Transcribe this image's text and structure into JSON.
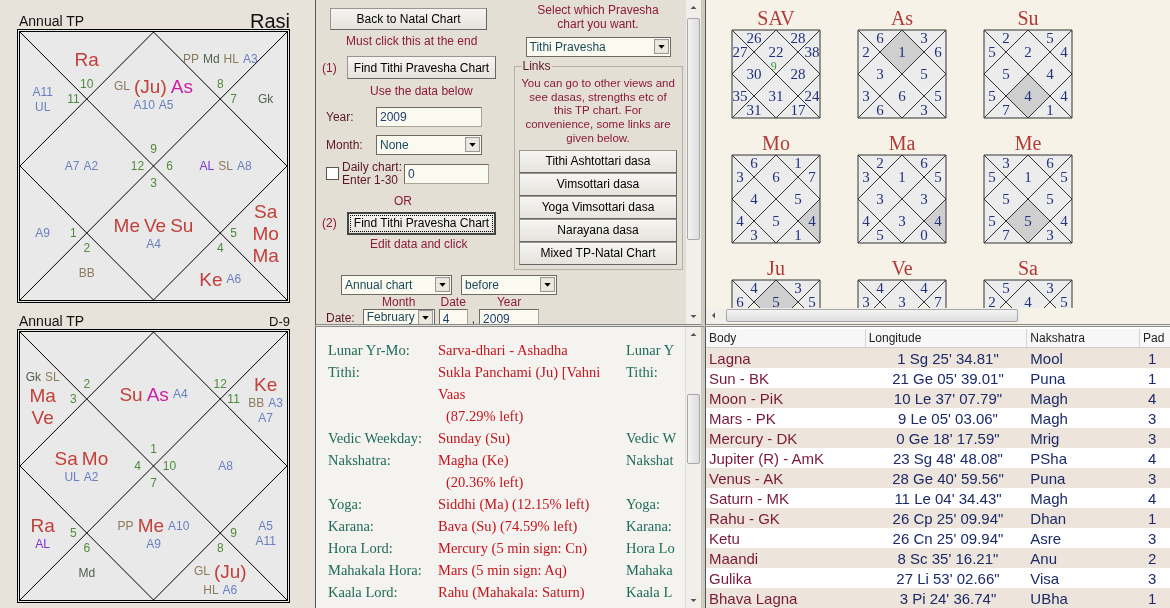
{
  "rasi_chart": {
    "title": "Annual TP",
    "name": "Rasi",
    "houses": [
      {
        "sign": "10",
        "items": [
          {
            "text": "Ra",
            "kind": "graha"
          }
        ]
      },
      {
        "sign": "8",
        "items": [
          {
            "text": "PP",
            "kind": "special_lagna"
          },
          {
            "text": "Md",
            "kind": "upagraha"
          },
          {
            "text": "HL",
            "kind": "special_lagna"
          },
          {
            "text": "A3",
            "kind": "arudha"
          }
        ]
      },
      {
        "sign": "11",
        "items": [
          {
            "text": "A11",
            "kind": "arudha"
          },
          {
            "text": "UL",
            "kind": "arudha"
          }
        ]
      },
      {
        "sign": "9",
        "items": [
          {
            "text": "GL",
            "kind": "special_lagna"
          },
          {
            "text": "(Ju)",
            "kind": "graha"
          },
          {
            "text": "As",
            "kind": "ascendant"
          },
          {
            "text": "A10",
            "kind": "arudha"
          },
          {
            "text": "A5",
            "kind": "arudha"
          }
        ]
      },
      {
        "sign": "7",
        "items": [
          {
            "text": "Gk",
            "kind": "upagraha"
          }
        ]
      },
      {
        "sign": "12",
        "items": [
          {
            "text": "A7",
            "kind": "arudha"
          },
          {
            "text": "A2",
            "kind": "arudha"
          }
        ]
      },
      {
        "sign": "6",
        "items": [
          {
            "text": "AL",
            "kind": "arudha_lagna"
          },
          {
            "text": "SL",
            "kind": "special_lagna"
          },
          {
            "text": "A8",
            "kind": "arudha"
          }
        ]
      },
      {
        "sign": "1",
        "items": [
          {
            "text": "A9",
            "kind": "arudha"
          }
        ]
      },
      {
        "sign": "3",
        "items": [
          {
            "text": "Me",
            "kind": "graha"
          },
          {
            "text": "Ve",
            "kind": "graha"
          },
          {
            "text": "Su",
            "kind": "graha"
          },
          {
            "text": "A4",
            "kind": "arudha"
          }
        ]
      },
      {
        "sign": "5",
        "items": [
          {
            "text": "Sa",
            "kind": "graha"
          },
          {
            "text": "Mo",
            "kind": "graha"
          },
          {
            "text": "Ma",
            "kind": "graha"
          }
        ]
      },
      {
        "sign": "2",
        "items": [
          {
            "text": "BB",
            "kind": "special_lagna"
          }
        ]
      },
      {
        "sign": "4",
        "items": [
          {
            "text": "Ke",
            "kind": "graha"
          },
          {
            "text": "A6",
            "kind": "arudha"
          }
        ]
      }
    ]
  },
  "navamsa_chart": {
    "title": "Annual TP",
    "name": "D-9",
    "houses": [
      {
        "sign": "2"
      },
      {
        "sign": "12"
      },
      {
        "sign": "3",
        "items": [
          {
            "text": "Gk",
            "kind": "upagraha"
          },
          {
            "text": "SL",
            "kind": "special_lagna"
          },
          {
            "text": "Ma",
            "kind": "graha"
          },
          {
            "text": "Ve",
            "kind": "graha"
          }
        ]
      },
      {
        "sign": "1",
        "items": [
          {
            "text": "Su",
            "kind": "graha"
          },
          {
            "text": "As",
            "kind": "ascendant"
          },
          {
            "text": "A4",
            "kind": "arudha"
          }
        ]
      },
      {
        "sign": "11",
        "items": [
          {
            "text": "Ke",
            "kind": "graha"
          },
          {
            "text": "BB",
            "kind": "special_lagna"
          },
          {
            "text": "A3",
            "kind": "arudha"
          },
          {
            "text": "A7",
            "kind": "arudha"
          }
        ]
      },
      {
        "sign": "4",
        "items": [
          {
            "text": "Sa",
            "kind": "graha"
          },
          {
            "text": "Mo",
            "kind": "graha"
          },
          {
            "text": "UL",
            "kind": "arudha"
          },
          {
            "text": "A2",
            "kind": "arudha"
          }
        ]
      },
      {
        "sign": "10",
        "items": [
          {
            "text": "A8",
            "kind": "arudha"
          }
        ]
      },
      {
        "sign": "5",
        "items": [
          {
            "text": "Ra",
            "kind": "graha"
          },
          {
            "text": "AL",
            "kind": "arudha_lagna"
          }
        ]
      },
      {
        "sign": "7",
        "items": [
          {
            "text": "PP",
            "kind": "special_lagna"
          },
          {
            "text": "Me",
            "kind": "graha"
          },
          {
            "text": "A10",
            "kind": "arudha"
          },
          {
            "text": "A9",
            "kind": "arudha"
          }
        ]
      },
      {
        "sign": "9",
        "items": [
          {
            "text": "A5",
            "kind": "arudha"
          },
          {
            "text": "A11",
            "kind": "arudha"
          }
        ]
      },
      {
        "sign": "6",
        "items": [
          {
            "text": "Md",
            "kind": "upagraha"
          }
        ]
      },
      {
        "sign": "8",
        "items": [
          {
            "text": "GL",
            "kind": "special_lagna"
          },
          {
            "text": "(Ju)",
            "kind": "graha"
          },
          {
            "text": "HL",
            "kind": "special_lagna"
          },
          {
            "text": "A6",
            "kind": "arudha"
          }
        ]
      }
    ]
  },
  "form": {
    "back_button": "Back to Natal Chart",
    "back_note": "Must click this at the end",
    "step_1": "(1)",
    "find_button_1": "Find Tithi Pravesha Chart",
    "note_1": "Use the data below",
    "year_label": "Year:",
    "year": "2009",
    "month_label": "Month:",
    "month": "None",
    "daily_chart": {
      "label": "Daily chart: Enter 1-30",
      "checked": false,
      "value": "0"
    },
    "or": "OR",
    "step_2": "(2)",
    "find_button_2": {
      "label": "Find Tithi Pravesha Chart",
      "focused": true
    },
    "note_2": "Edit data and click",
    "chart_type": "Annual chart",
    "direction": "before",
    "date": {
      "label": "Date:",
      "month_label": "Month",
      "month": "February",
      "date_label": "Date",
      "date": "4",
      "separator": ",",
      "year_label": "Year",
      "year": "2009"
    },
    "pravesha_prompt": "Select which Pravesha chart you want.",
    "pravesha_type": "Tithi Pravesha",
    "links": {
      "title": "Links",
      "text": "You can go to other views and see dasas, strengths etc of this TP chart. For convenience, some links are given below.",
      "buttons": [
        "Tithi Ashtottari dasa",
        "Vimsottari dasa",
        "Yoga Vimsottari dasa",
        "Narayana dasa",
        "Mixed TP-Natal Chart"
      ]
    }
  },
  "panchanga": [
    {
      "label": "Lunar Yr-Mo:",
      "value": "Sarva-dhari - Ashadha",
      "label_2": "Lunar Y"
    },
    {
      "label": "Tithi:",
      "value": "Sukla Panchami (Ju) [Vahni Vaas",
      "note": "(87.29% left)",
      "label_2": "Tithi:"
    },
    {
      "label": "Vedic Weekday:",
      "value": "Sunday (Su)",
      "label_2": "Vedic W"
    },
    {
      "label": "Nakshatra:",
      "value": "Magha (Ke)",
      "note": "(20.36% left)",
      "label_2": "Nakshat"
    },
    {
      "label": "Yoga:",
      "value": "Siddhi (Ma) (12.15% left)",
      "label_2": "Yoga:"
    },
    {
      "label": "Karana:",
      "value": "Bava (Su) (74.59% left)",
      "label_2": "Karana:"
    },
    {
      "label": "Hora Lord:",
      "value": "Mercury (5 min sign: Cn)",
      "label_2": "Hora Lo"
    },
    {
      "label": "Mahakala Hora:",
      "value": "Mars (5 min sign: Aq)",
      "label_2": "Mahaka"
    },
    {
      "label": "Kaala Lord:",
      "value": "Rahu (Mahakala: Saturn)",
      "label_2": "Kaala L"
    }
  ],
  "ashtakavarga": [
    {
      "title": "SAV",
      "sign": "9",
      "houses": [
        {
          "value": "26",
          "highlighted": false
        },
        {
          "value": "28",
          "highlighted": false
        },
        {
          "value": "27",
          "highlighted": false
        },
        {
          "value": "22",
          "highlighted": false
        },
        {
          "value": "38",
          "highlighted": false
        },
        {
          "value": "30",
          "highlighted": false
        },
        {
          "value": "28",
          "highlighted": false
        },
        {
          "value": "35",
          "highlighted": false
        },
        {
          "value": "31",
          "highlighted": false
        },
        {
          "value": "24",
          "highlighted": false
        },
        {
          "value": "31",
          "highlighted": false
        },
        {
          "value": "17",
          "highlighted": false
        }
      ]
    },
    {
      "title": "As",
      "houses": [
        {
          "value": "6",
          "highlighted": false
        },
        {
          "value": "3",
          "highlighted": false
        },
        {
          "value": "2",
          "highlighted": false
        },
        {
          "value": "1",
          "highlighted": true
        },
        {
          "value": "6",
          "highlighted": false
        },
        {
          "value": "3",
          "highlighted": false
        },
        {
          "value": "5",
          "highlighted": false
        },
        {
          "value": "3",
          "highlighted": false
        },
        {
          "value": "6",
          "highlighted": false
        },
        {
          "value": "5",
          "highlighted": false
        },
        {
          "value": "6",
          "highlighted": false
        },
        {
          "value": "3",
          "highlighted": false
        }
      ]
    },
    {
      "title": "Su",
      "houses": [
        {
          "value": "2",
          "highlighted": false
        },
        {
          "value": "5",
          "highlighted": false
        },
        {
          "value": "5",
          "highlighted": false
        },
        {
          "value": "2",
          "highlighted": false
        },
        {
          "value": "4",
          "highlighted": false
        },
        {
          "value": "5",
          "highlighted": false
        },
        {
          "value": "4",
          "highlighted": false
        },
        {
          "value": "5",
          "highlighted": false
        },
        {
          "value": "4",
          "highlighted": true
        },
        {
          "value": "4",
          "highlighted": false
        },
        {
          "value": "7",
          "highlighted": false
        },
        {
          "value": "1",
          "highlighted": false
        }
      ]
    },
    {
      "title": "Mo",
      "houses": [
        {
          "value": "6",
          "highlighted": false
        },
        {
          "value": "1",
          "highlighted": false
        },
        {
          "value": "3",
          "highlighted": false
        },
        {
          "value": "6",
          "highlighted": false
        },
        {
          "value": "7",
          "highlighted": false
        },
        {
          "value": "4",
          "highlighted": false
        },
        {
          "value": "5",
          "highlighted": false
        },
        {
          "value": "4",
          "highlighted": false
        },
        {
          "value": "5",
          "highlighted": false
        },
        {
          "value": "4",
          "highlighted": true
        },
        {
          "value": "3",
          "highlighted": false
        },
        {
          "value": "1",
          "highlighted": false
        }
      ]
    },
    {
      "title": "Ma",
      "houses": [
        {
          "value": "2",
          "highlighted": false
        },
        {
          "value": "6",
          "highlighted": false
        },
        {
          "value": "3",
          "highlighted": false
        },
        {
          "value": "1",
          "highlighted": false
        },
        {
          "value": "5",
          "highlighted": false
        },
        {
          "value": "3",
          "highlighted": false
        },
        {
          "value": "3",
          "highlighted": false
        },
        {
          "value": "4",
          "highlighted": false
        },
        {
          "value": "3",
          "highlighted": false
        },
        {
          "value": "4",
          "highlighted": true
        },
        {
          "value": "5",
          "highlighted": false
        },
        {
          "value": "0",
          "highlighted": false
        }
      ]
    },
    {
      "title": "Me",
      "houses": [
        {
          "value": "3",
          "highlighted": false
        },
        {
          "value": "6",
          "highlighted": false
        },
        {
          "value": "5",
          "highlighted": false
        },
        {
          "value": "1",
          "highlighted": false
        },
        {
          "value": "5",
          "highlighted": false
        },
        {
          "value": "5",
          "highlighted": false
        },
        {
          "value": "5",
          "highlighted": false
        },
        {
          "value": "5",
          "highlighted": false
        },
        {
          "value": "5",
          "highlighted": true
        },
        {
          "value": "4",
          "highlighted": false
        },
        {
          "value": "7",
          "highlighted": false
        },
        {
          "value": "3",
          "highlighted": false
        }
      ]
    },
    {
      "title": "Ju",
      "houses": [
        {
          "value": "4",
          "highlighted": false
        },
        {
          "value": "3",
          "highlighted": false
        },
        {
          "value": "6",
          "highlighted": false
        },
        {
          "value": "5",
          "highlighted": true
        },
        {
          "value": "5",
          "highlighted": false
        }
      ]
    },
    {
      "title": "Ve",
      "houses": [
        {
          "value": "4",
          "highlighted": false
        },
        {
          "value": "4",
          "highlighted": false
        },
        {
          "value": "3",
          "highlighted": false
        },
        {
          "value": "3",
          "highlighted": false
        },
        {
          "value": "7",
          "highlighted": false
        }
      ]
    },
    {
      "title": "Sa",
      "houses": [
        {
          "value": "5",
          "highlighted": false
        },
        {
          "value": "3",
          "highlighted": false
        },
        {
          "value": "2",
          "highlighted": false
        },
        {
          "value": "4",
          "highlighted": false
        },
        {
          "value": "5",
          "highlighted": false
        }
      ]
    }
  ],
  "planets_table": {
    "columns": [
      "Body",
      "Longitude",
      "Nakshatra",
      "Pad"
    ],
    "rows": [
      [
        "Lagna",
        "1 Sg 25' 34.81\"",
        "Mool",
        "1"
      ],
      [
        "Sun - BK",
        "21 Ge 05' 39.01\"",
        "Puna",
        "1"
      ],
      [
        "Moon - PiK",
        "10 Le 37' 07.79\"",
        "Magh",
        "4"
      ],
      [
        "Mars - PK",
        "9 Le 05' 03.06\"",
        "Magh",
        "3"
      ],
      [
        "Mercury - DK",
        "0 Ge 18' 17.59\"",
        "Mrig",
        "3"
      ],
      [
        "Jupiter (R) - AmK",
        "23 Sg 48' 48.08\"",
        "PSha",
        "4"
      ],
      [
        "Venus - AK",
        "28 Ge 40' 59.56\"",
        "Puna",
        "3"
      ],
      [
        "Saturn - MK",
        "11 Le 04' 34.43\"",
        "Magh",
        "4"
      ],
      [
        "Rahu - GK",
        "26 Cp 25' 09.94\"",
        "Dhan",
        "1"
      ],
      [
        "Ketu",
        "26 Cn 25' 09.94\"",
        "Asre",
        "3"
      ],
      [
        "Maandi",
        "8 Sc 35' 16.21\"",
        "Anu",
        "2"
      ],
      [
        "Gulika",
        "27 Li 53' 02.66\"",
        "Visa",
        "3"
      ],
      [
        "Bhava Lagna",
        "3 Pi 24' 36.74\"",
        "UBha",
        "1"
      ]
    ]
  }
}
